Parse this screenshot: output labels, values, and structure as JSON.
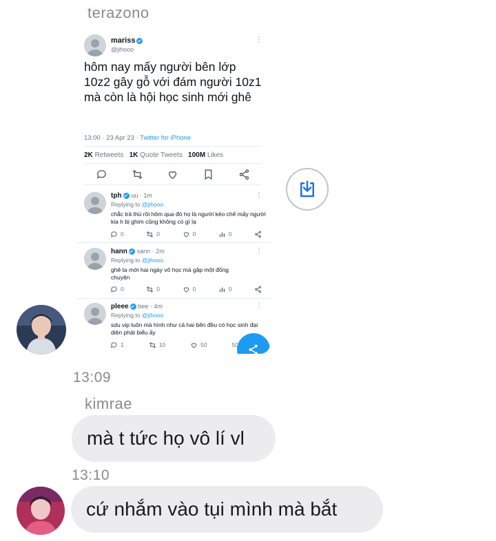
{
  "chat": {
    "sender_1": "terazono",
    "time_1": "13:09",
    "sender_2": "kimrae",
    "bubble_2": "mà t tức họ vô lí vl",
    "time_2": "13:10",
    "bubble_3": "cứ nhắm vào tụi mình mà bắt"
  },
  "tweet": {
    "name": "mariss",
    "handle": "@jihooo",
    "text": "hôm nay mấy người bên lớp 10z2 gây gỗ với đám người 10z1 mà còn là hội học sinh mới ghê",
    "time": "13:00 · 23 Apr 23 · ",
    "source": "Twitter for iPhone",
    "retweets_num": "2K",
    "retweets_label": " Retweets",
    "quotes_num": "1K",
    "quotes_label": " Quote Tweets",
    "likes_num": "100M",
    "likes_label": " Likes"
  },
  "replies": [
    {
      "name": "tph",
      "handle": "uu · 1m",
      "replying_prefix": "Replying to ",
      "replying_to": "@jihooo",
      "text": "chắc trả thù rồi hôm qua đó họ là người kéo chế mấy người kia h bị ghim cũng không có gì lạ",
      "replies": "0",
      "retweets": "0",
      "likes": "0",
      "views": "0"
    },
    {
      "name": "hann",
      "handle": "sann · 2m",
      "replying_prefix": "Replying to ",
      "replying_to": "@jihooo",
      "text": "ghê ta mới hai ngày vô học mà gặp một đống chuyện",
      "replies": "0",
      "retweets": "0",
      "likes": "0",
      "views": "0"
    },
    {
      "name": "pleee",
      "handle": "bee · 4m",
      "replying_prefix": "Replying to ",
      "replying_to": "@jihooo",
      "text": "sdu vip luôn mà hình như cả hai bên đều có học sinh đại diện phát biểu ấy",
      "replies": "1",
      "retweets": "10",
      "likes": "50",
      "views": "50"
    }
  ],
  "icons": {
    "save": "save-download-icon",
    "share": "share-icon",
    "reply": "reply-icon",
    "retweet": "retweet-icon",
    "like": "heart-icon",
    "bookmark": "bookmark-icon",
    "views": "views-icon",
    "more": "more-dots-icon"
  },
  "colors": {
    "twitter_blue": "#1d9bf0",
    "bubble_bg": "#ececef",
    "meta_gray": "#8a8a8a"
  }
}
